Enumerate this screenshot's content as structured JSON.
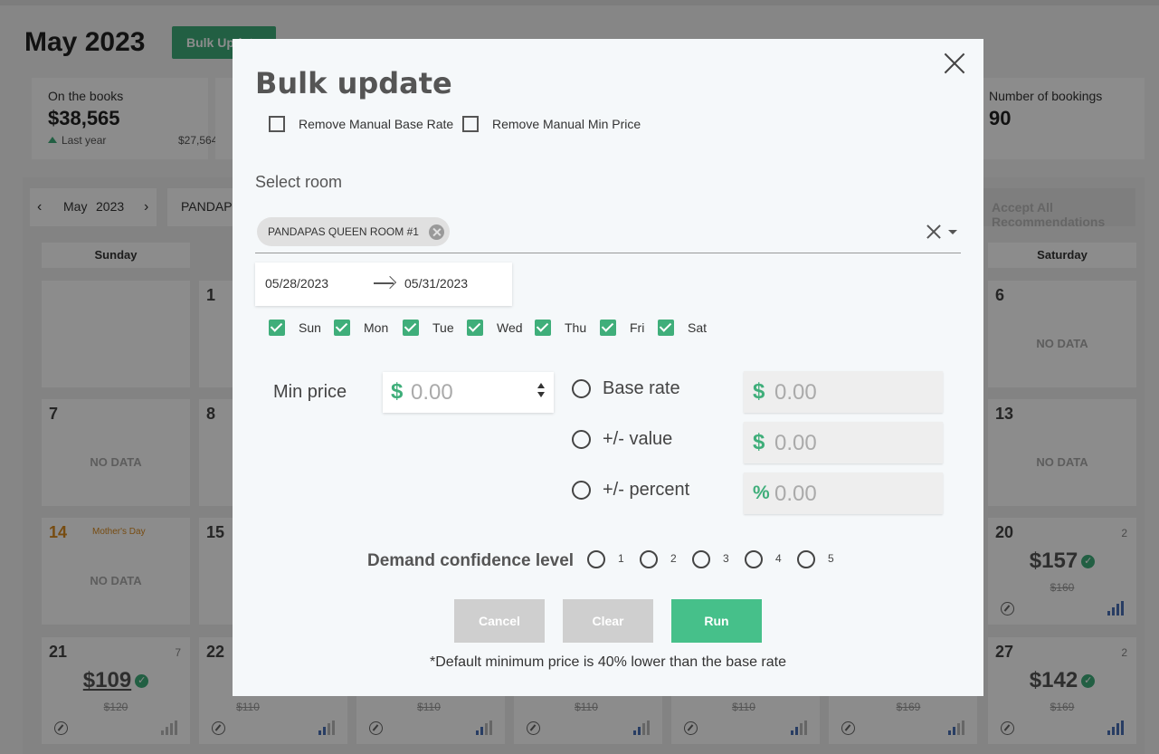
{
  "page": {
    "title": "May 2023",
    "bulk_update_button": "Bulk Update",
    "stats": [
      {
        "label": "On the books",
        "value": "$38,565",
        "sub_label": "Last year",
        "sub_value": "$27,564"
      },
      {
        "label": "Number of bookings",
        "value": "90"
      }
    ],
    "calendar_nav": {
      "month": "May",
      "year": "2023"
    },
    "room_filter": "PANDAP",
    "accept_all_label": "Accept All Recommendations",
    "weekday_headers": {
      "sunday": "Sunday",
      "saturday": "Saturday"
    }
  },
  "calendar": {
    "no_data_label": "NO DATA",
    "cells": {
      "c1": {
        "day": "1"
      },
      "c6": {
        "day": "6"
      },
      "c7": {
        "day": "7"
      },
      "c8": {
        "day": "8"
      },
      "c13": {
        "day": "13"
      },
      "c14": {
        "day": "14",
        "holiday": "Mother's Day"
      },
      "c15": {
        "day": "15"
      },
      "c20": {
        "day": "20",
        "count": "2",
        "price": "$157",
        "old_price": "$160"
      },
      "c21": {
        "day": "21",
        "count": "7",
        "price": "$109",
        "old_price": "$120"
      },
      "c22": {
        "day": "22",
        "old_price": "$110"
      },
      "c23": {
        "old_price": "$110"
      },
      "c24": {
        "old_price": "$110"
      },
      "c25": {
        "old_price": "$110"
      },
      "c26": {
        "old_price": "$169"
      },
      "c27": {
        "day": "27",
        "count": "2",
        "price": "$142",
        "old_price": "$169"
      }
    }
  },
  "modal": {
    "title": "Bulk update",
    "remove_manual_base_rate": "Remove Manual Base Rate",
    "remove_manual_min_price": "Remove Manual Min Price",
    "select_room_label": "Select room",
    "selected_room": "PANDAPAS QUEEN ROOM #1",
    "date_from": "05/28/2023",
    "date_to": "05/31/2023",
    "days": [
      "Sun",
      "Mon",
      "Tue",
      "Wed",
      "Thu",
      "Fri",
      "Sat"
    ],
    "min_price_label": "Min price",
    "currency_symbol": "$",
    "percent_symbol": "%",
    "min_price_value": "0.00",
    "options": {
      "base_rate": {
        "label": "Base rate",
        "value": "0.00"
      },
      "plus_minus_value": {
        "label": "+/- value",
        "value": "0.00"
      },
      "plus_minus_percent": {
        "label": "+/- percent",
        "value": "0.00"
      }
    },
    "demand_confidence_label": "Demand confidence level",
    "levels": [
      "1",
      "2",
      "3",
      "4",
      "5"
    ],
    "cancel_label": "Cancel",
    "clear_label": "Clear",
    "run_label": "Run",
    "footnote": "*Default minimum price is 40% lower than the base rate"
  },
  "colors": {
    "accent": "#3fae7a",
    "run_button": "#46c08a",
    "holiday": "#d98a20",
    "disabled_button": "#cfcfcf"
  }
}
